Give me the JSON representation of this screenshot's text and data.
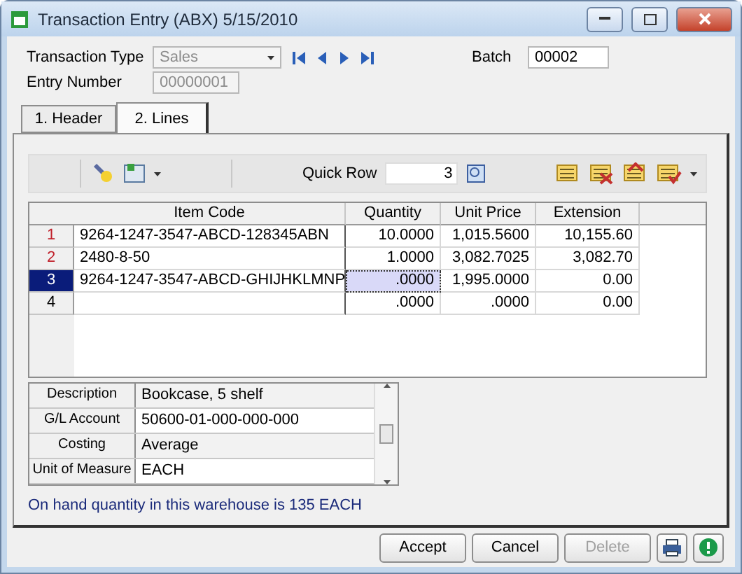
{
  "window": {
    "title": "Transaction Entry (ABX) 5/15/2010"
  },
  "header": {
    "transaction_type": {
      "label": "Transaction Type",
      "value": "Sales",
      "disabled": true
    },
    "batch": {
      "label": "Batch",
      "value": "00002"
    },
    "entry_number": {
      "label": "Entry Number",
      "value": "00000001",
      "disabled": true
    }
  },
  "tabs": [
    {
      "label": "1. Header",
      "selected": false
    },
    {
      "label": "2. Lines",
      "selected": true
    }
  ],
  "toolbar": {
    "quick_row": {
      "label": "Quick Row",
      "value": "3"
    }
  },
  "grid": {
    "columns": [
      "Item Code",
      "Quantity",
      "Unit Price",
      "Extension"
    ],
    "rows": [
      {
        "number": "1",
        "kind": "line",
        "selected": false,
        "cells": [
          "9264-1247-3547-ABCD-128345ABN",
          "10.0000",
          "1,015.5600",
          "10,155.60"
        ]
      },
      {
        "number": "2",
        "kind": "line",
        "selected": false,
        "cells": [
          "2480-8-50",
          "1.0000",
          "3,082.7025",
          "3,082.70"
        ]
      },
      {
        "number": "3",
        "kind": "line",
        "selected": true,
        "cells": [
          "9264-1247-3547-ABCD-GHIJHKLMNP",
          ".0000",
          "1,995.0000",
          "0.00"
        ]
      },
      {
        "number": "4",
        "kind": "blank",
        "selected": false,
        "cells": [
          "",
          ".0000",
          ".0000",
          "0.00"
        ]
      }
    ]
  },
  "details": [
    {
      "label": "Description",
      "value": "Bookcase, 5 shelf",
      "editable": false
    },
    {
      "label": "G/L Account",
      "value": "50600-01-000-000-000",
      "editable": true
    },
    {
      "label": "Costing",
      "value": "Average",
      "editable": false
    },
    {
      "label": "Unit of Measure",
      "value": "EACH",
      "editable": true
    }
  ],
  "status": "On hand quantity in this warehouse is 135 EACH",
  "buttons": [
    {
      "label": "Accept",
      "disabled": false
    },
    {
      "label": "Cancel",
      "disabled": false
    },
    {
      "label": "Delete",
      "disabled": true
    }
  ]
}
